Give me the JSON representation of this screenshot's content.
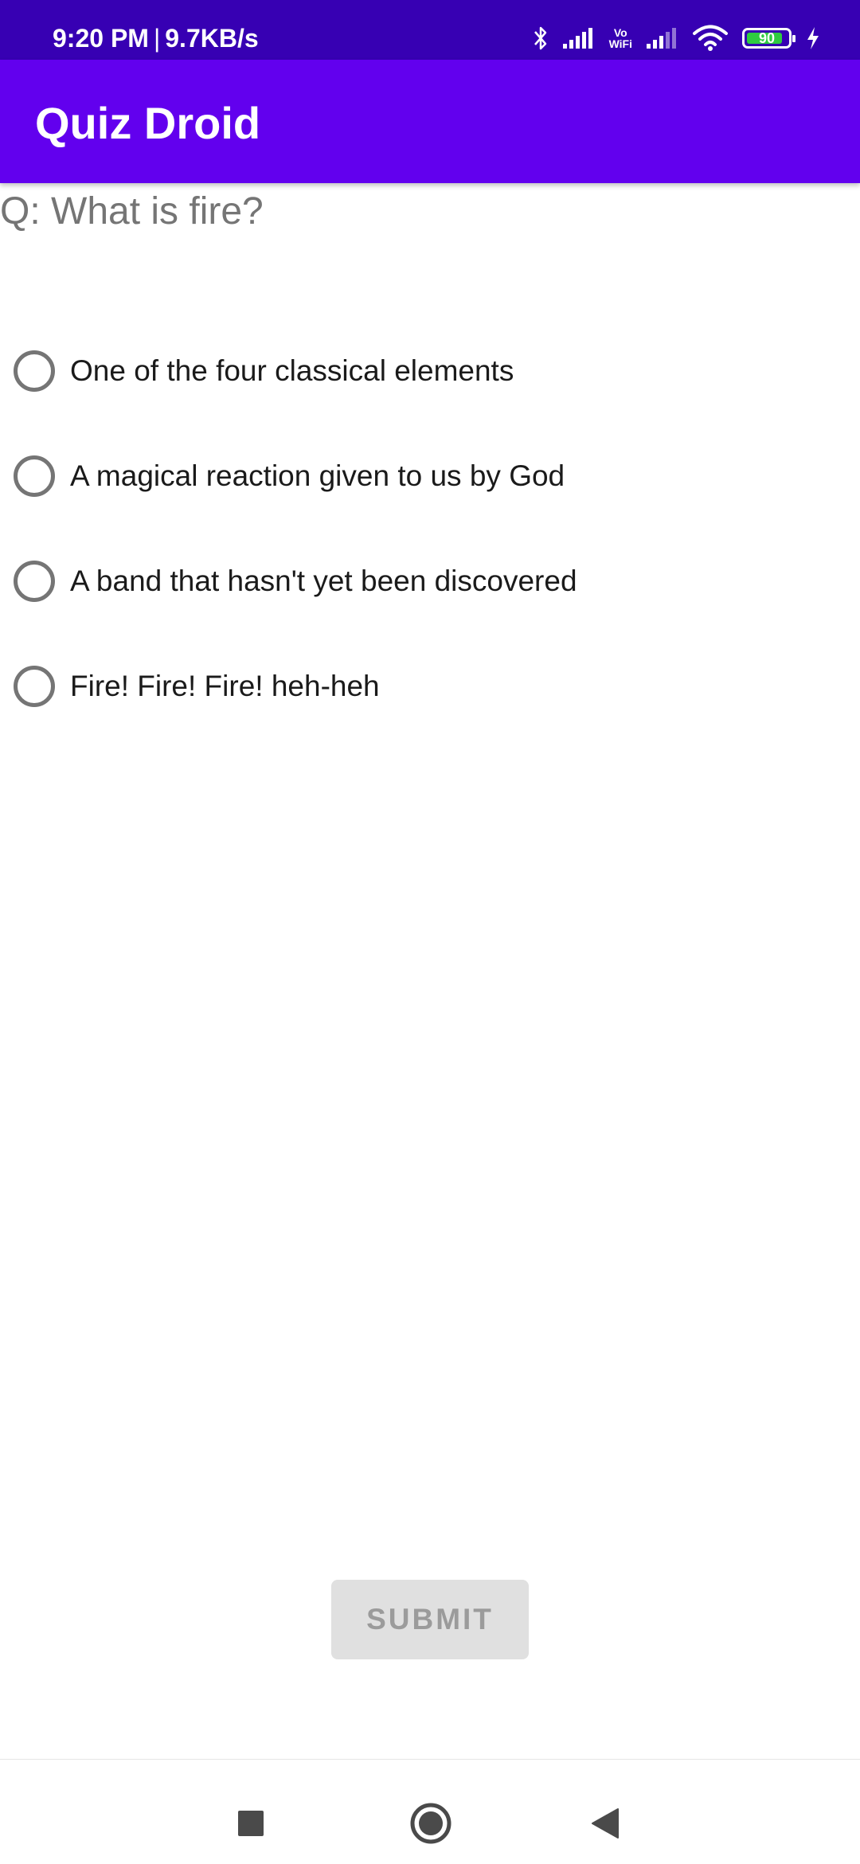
{
  "status_bar": {
    "time": "9:20 PM",
    "separator": "|",
    "speed": "9.7KB/s",
    "battery_level": "90",
    "vowifi_top": "Vo",
    "vowifi_bottom": "WiFi",
    "icons": [
      "bluetooth-icon",
      "signal-icon",
      "vowifi-icon",
      "signal-icon",
      "wifi-icon",
      "battery-icon",
      "charging-icon"
    ]
  },
  "app_bar": {
    "title": "Quiz Droid"
  },
  "quiz": {
    "question": "Q: What is fire?",
    "options": [
      {
        "label": "One of the four classical elements",
        "selected": false
      },
      {
        "label": "A magical reaction given to us by God",
        "selected": false
      },
      {
        "label": "A band that hasn't yet been discovered",
        "selected": false
      },
      {
        "label": "Fire! Fire! Fire! heh-heh",
        "selected": false
      }
    ],
    "submit_label": "SUBMIT"
  },
  "nav_bar": {
    "icons": [
      "recents-square-icon",
      "home-circle-icon",
      "back-triangle-icon"
    ]
  },
  "colors": {
    "status_bar": "#3700b3",
    "app_bar": "#6200ee",
    "question_text": "#757575",
    "radio": "#757575",
    "submit_bg": "#e0e0e0",
    "submit_text": "#9b9b9b"
  }
}
